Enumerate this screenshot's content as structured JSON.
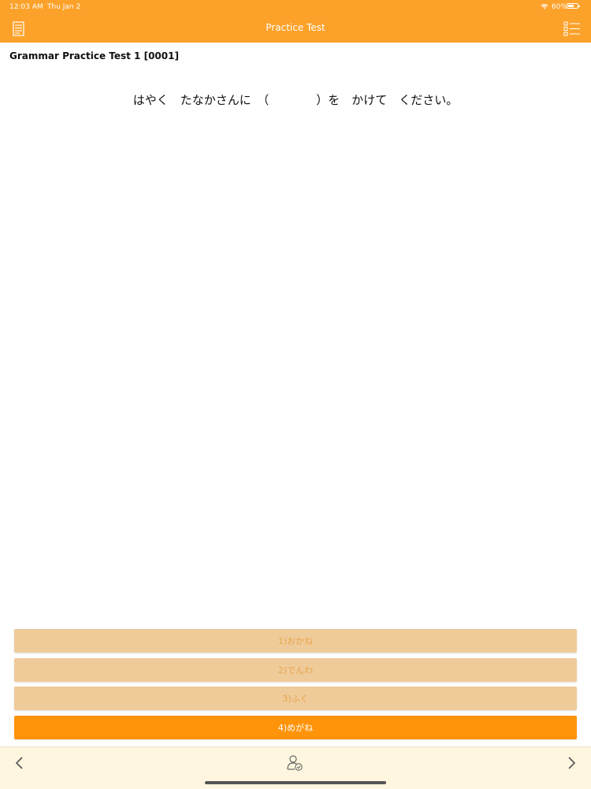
{
  "status_bar": {
    "time": "12:03 AM",
    "date": "Thu Jan 2",
    "battery": "60%"
  },
  "nav": {
    "title": "Practice Test",
    "left_icon": "document-list-icon",
    "right_icon": "checklist-icon"
  },
  "test": {
    "title": "Grammar Practice Test 1 [0001]",
    "question": "はやく　たなかさんに　（　　　　）を　かけて　ください。"
  },
  "answers": [
    {
      "label": "1)おかね",
      "state": "dim"
    },
    {
      "label": "2)でんわ",
      "state": "dim"
    },
    {
      "label": "3)ふく",
      "state": "dim"
    },
    {
      "label": "4)めがね",
      "state": "active"
    }
  ],
  "bottom_bar": {
    "prev_icon": "chevron-left-icon",
    "check_icon": "user-check-icon",
    "next_icon": "chevron-right-icon"
  },
  "colors": {
    "accent": "#fca22a",
    "answer_active": "#ff9309",
    "answer_dim": "#efcb9a",
    "bottom_bar": "#fef6df"
  }
}
